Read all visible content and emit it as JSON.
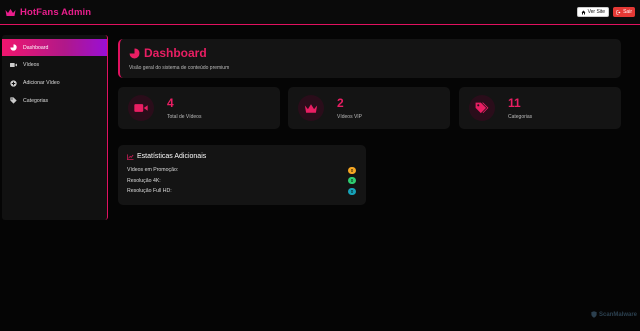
{
  "topbar": {
    "brand": "HotFans Admin",
    "ver_site": "Ver Site",
    "sair": "Sair"
  },
  "sidebar": {
    "items": [
      {
        "label": "Dashboard",
        "icon": "pie-chart-icon",
        "active": true
      },
      {
        "label": "Vídeos",
        "icon": "video-camera-icon",
        "active": false
      },
      {
        "label": "Adicionar Vídeo",
        "icon": "plus-circle-icon",
        "active": false
      },
      {
        "label": "Categorias",
        "icon": "tag-icon",
        "active": false
      }
    ]
  },
  "header": {
    "title": "Dashboard",
    "subtitle": "Visão geral do sistema de conteúdo premium"
  },
  "stats": [
    {
      "value": "4",
      "label": "Total de Vídeos",
      "icon": "video-camera-icon"
    },
    {
      "value": "2",
      "label": "Vídeos VIP",
      "icon": "crown-icon"
    },
    {
      "value": "11",
      "label": "Categorias",
      "icon": "tags-icon"
    }
  ],
  "extra": {
    "title": "Estatísticas Adicionais",
    "rows": [
      {
        "label": "Vídeos em Promoção:",
        "value": "0",
        "color": "#f5a623"
      },
      {
        "label": "Resolução 4K:",
        "value": "0",
        "color": "#2ecc71"
      },
      {
        "label": "Resolução Full HD:",
        "value": "0",
        "color": "#17a2b8"
      }
    ]
  },
  "watermark": "ScanMalware",
  "colors": {
    "accent": "#e91e63",
    "purple": "#9a0fd6"
  }
}
